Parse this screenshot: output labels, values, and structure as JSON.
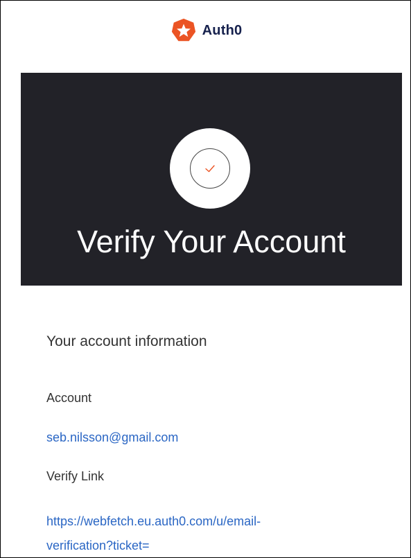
{
  "brand": {
    "name": "Auth0",
    "logo_color": "#eb5424"
  },
  "hero": {
    "title": "Verify Your Account",
    "background_color": "#222228",
    "check_color": "#eb5424"
  },
  "account_info": {
    "heading": "Your account information",
    "account_label": "Account",
    "account_email": "seb.nilsson@gmail.com",
    "verify_label": "Verify Link",
    "verify_link": "https://webfetch.eu.auth0.com/u/email-verification?ticket="
  },
  "colors": {
    "link": "#2a66c4",
    "text": "#333333"
  }
}
